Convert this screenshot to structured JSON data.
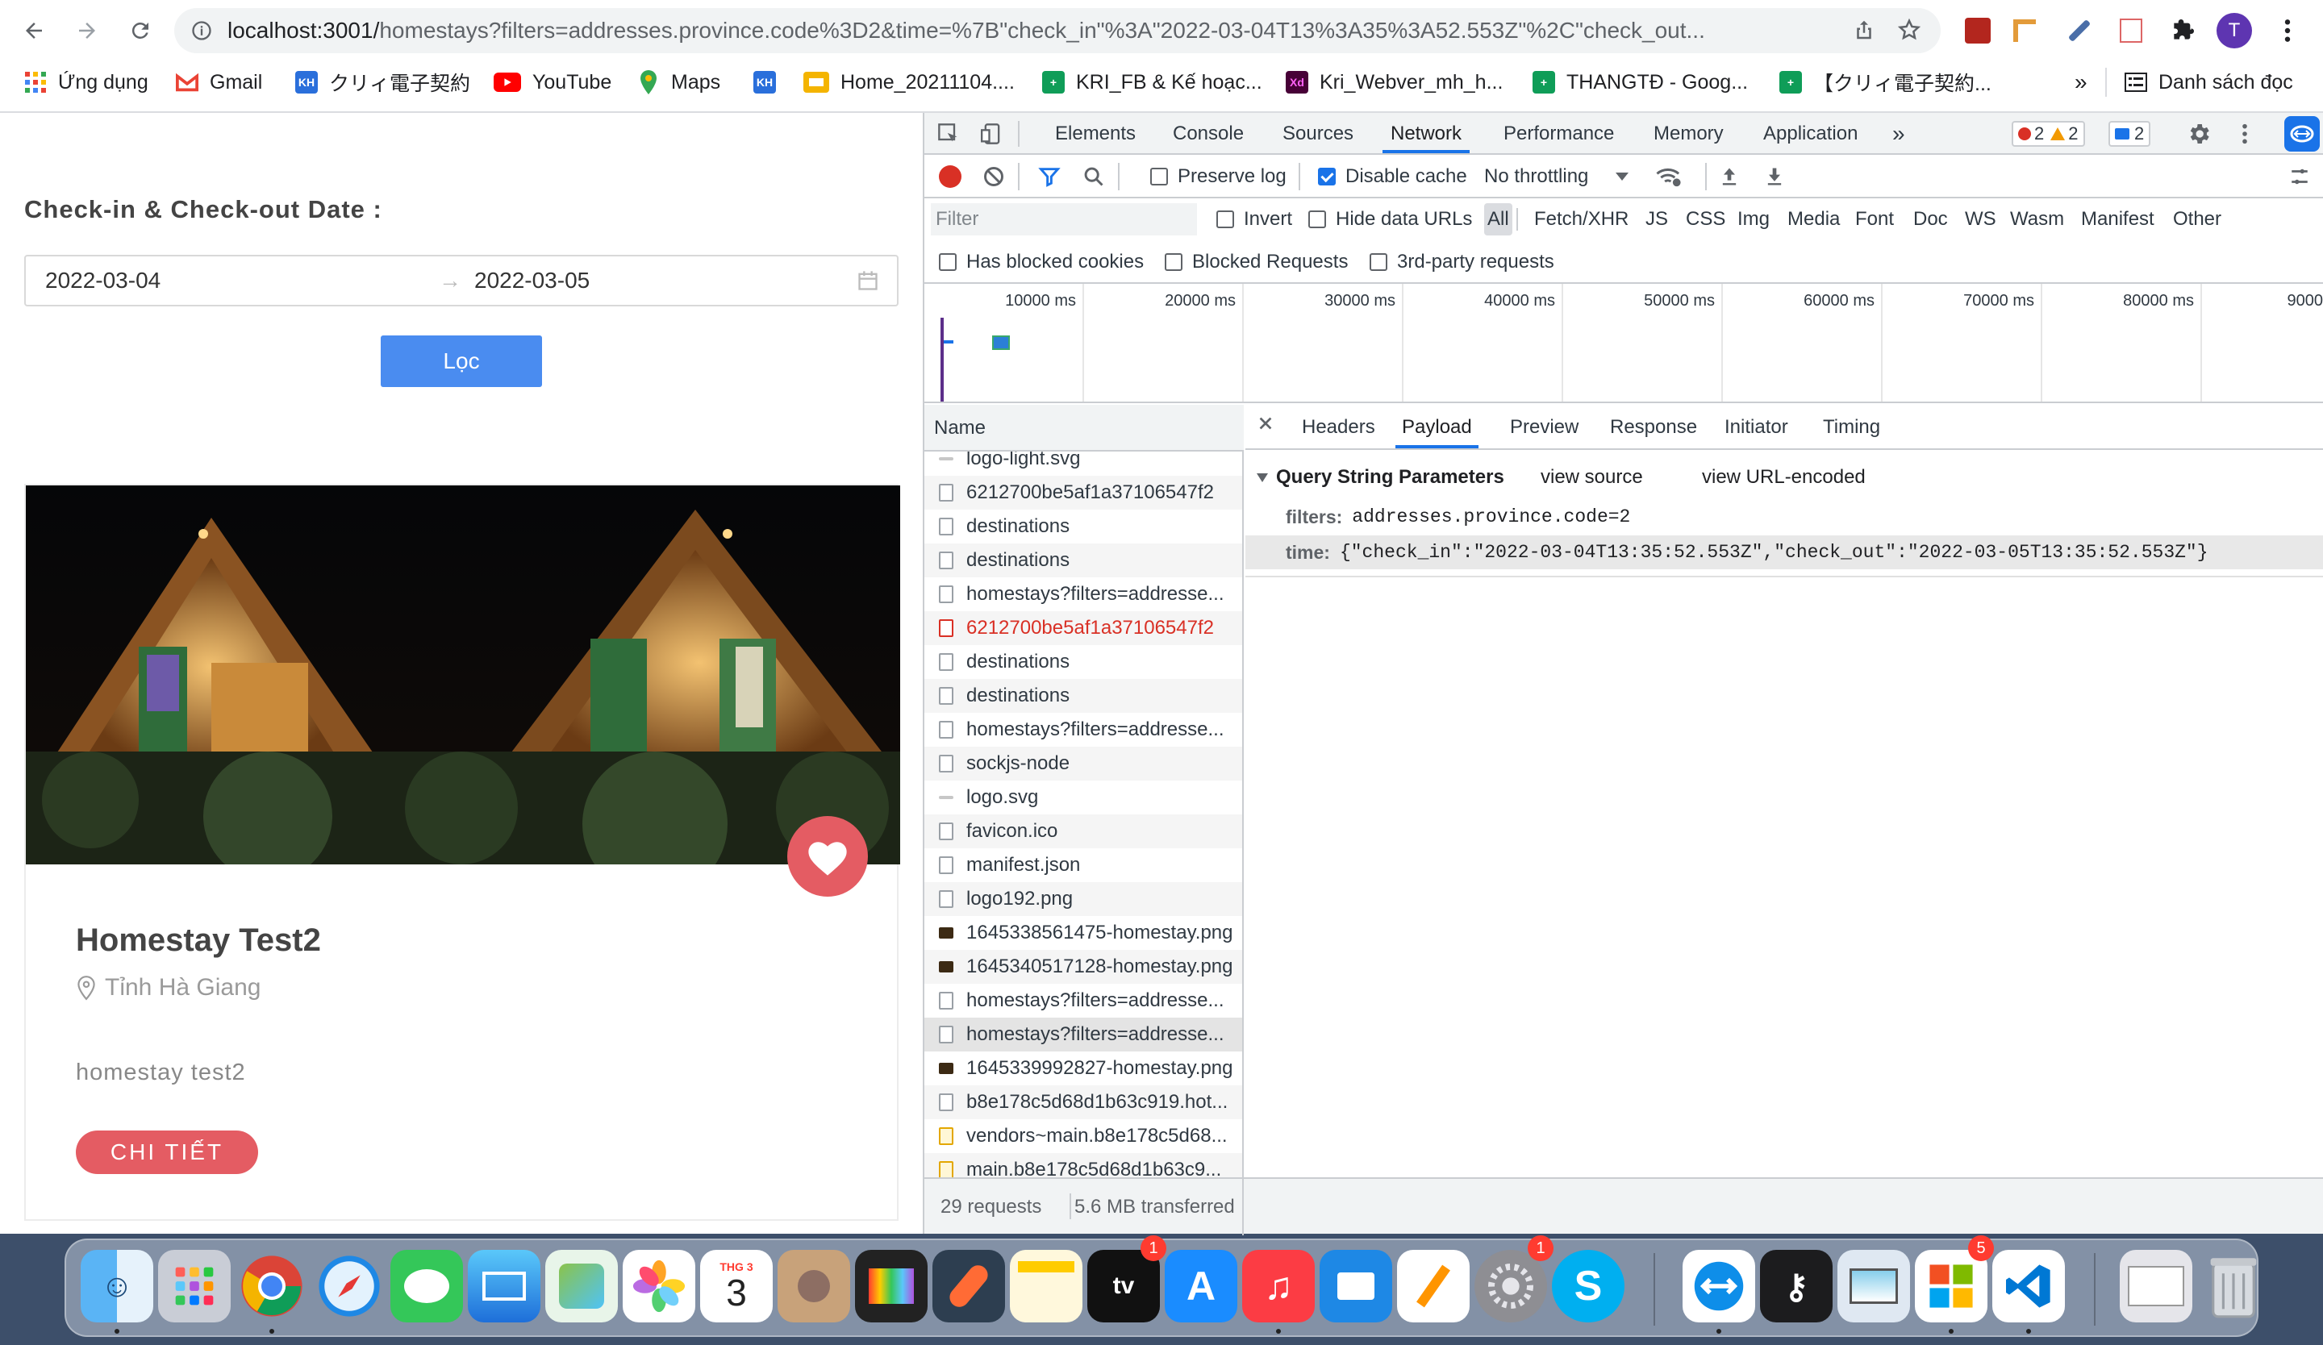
{
  "browser": {
    "url_host": "localhost:3001/",
    "url_rest": "homestays?filters=addresses.province.code%3D2&time=%7B\"check_in\"%3A\"2022-03-04T13%3A35%3A52.553Z\"%2C\"check_out...",
    "profile_initial": "T",
    "bookmarks": [
      {
        "label": "Ứng dụng",
        "icon": "apps-grid-icon"
      },
      {
        "label": "Gmail",
        "icon": "gmail-icon"
      },
      {
        "label": "クリィ電子契約",
        "icon": "kh-icon"
      },
      {
        "label": "YouTube",
        "icon": "youtube-icon"
      },
      {
        "label": "Maps",
        "icon": "maps-icon"
      },
      {
        "label": "",
        "icon": "kh-icon"
      },
      {
        "label": "Home_20211104....",
        "icon": "slides-icon"
      },
      {
        "label": "KRI_FB & Kế hoạc...",
        "icon": "sheets-icon"
      },
      {
        "label": "Kri_Webver_mh_h...",
        "icon": "xd-icon"
      },
      {
        "label": "THANGTĐ - Goog...",
        "icon": "sheets-icon"
      },
      {
        "label": "【クリィ電子契約...",
        "icon": "sheets-icon"
      }
    ],
    "bookmarks_overflow": "»",
    "reading_list": "Danh sách đọc"
  },
  "page": {
    "filter_label": "Check-in & Check-out Date :",
    "check_in": "2022-03-04",
    "check_out": "2022-03-05",
    "range_arrow": "→",
    "filter_button": "Lọc",
    "homestay": {
      "title": "Homestay Test2",
      "location": "Tỉnh Hà Giang",
      "description": "homestay test2",
      "detail_button": "CHI TIẾT"
    }
  },
  "devtools": {
    "tabs": [
      "Elements",
      "Console",
      "Sources",
      "Network",
      "Performance",
      "Memory",
      "Application"
    ],
    "more_tabs": "»",
    "errors": "2",
    "warnings": "2",
    "messages": "2",
    "toolbar": {
      "preserve_log": "Preserve log",
      "disable_cache": "Disable cache",
      "throttling": "No throttling"
    },
    "filter_placeholder": "Filter",
    "invert": "Invert",
    "hide_data_urls": "Hide data URLs",
    "types": [
      "All",
      "Fetch/XHR",
      "JS",
      "CSS",
      "Img",
      "Media",
      "Font",
      "Doc",
      "WS",
      "Wasm",
      "Manifest",
      "Other"
    ],
    "has_blocked_cookies": "Has blocked cookies",
    "blocked_requests": "Blocked Requests",
    "third_party": "3rd-party requests",
    "timeline_ticks": [
      "10000 ms",
      "20000 ms",
      "30000 ms",
      "40000 ms",
      "50000 ms",
      "60000 ms",
      "70000 ms",
      "80000 ms",
      "9000"
    ],
    "name_header": "Name",
    "requests": [
      {
        "name": "logo-light.svg",
        "type": "svg"
      },
      {
        "name": "6212700be5af1a37106547f2",
        "type": "doc"
      },
      {
        "name": "destinations",
        "type": "doc"
      },
      {
        "name": "destinations",
        "type": "doc"
      },
      {
        "name": "homestays?filters=addresse...",
        "type": "doc"
      },
      {
        "name": "6212700be5af1a37106547f2",
        "type": "err"
      },
      {
        "name": "destinations",
        "type": "doc"
      },
      {
        "name": "destinations",
        "type": "doc"
      },
      {
        "name": "homestays?filters=addresse...",
        "type": "doc"
      },
      {
        "name": "sockjs-node",
        "type": "doc"
      },
      {
        "name": "logo.svg",
        "type": "svg"
      },
      {
        "name": "favicon.ico",
        "type": "doc"
      },
      {
        "name": "manifest.json",
        "type": "doc"
      },
      {
        "name": "logo192.png",
        "type": "doc"
      },
      {
        "name": "1645338561475-homestay.png",
        "type": "img"
      },
      {
        "name": "1645340517128-homestay.png",
        "type": "img"
      },
      {
        "name": "homestays?filters=addresse...",
        "type": "doc"
      },
      {
        "name": "homestays?filters=addresse...",
        "type": "sel"
      },
      {
        "name": "1645339992827-homestay.png",
        "type": "img"
      },
      {
        "name": "b8e178c5d68d1b63c919.hot...",
        "type": "doc"
      },
      {
        "name": "vendors~main.b8e178c5d68...",
        "type": "js"
      },
      {
        "name": "main.b8e178c5d68d1b63c9...",
        "type": "js"
      }
    ],
    "status": {
      "requests": "29 requests",
      "transferred": "5.6 MB transferred"
    },
    "detail_tabs": [
      "Headers",
      "Payload",
      "Preview",
      "Response",
      "Initiator",
      "Timing"
    ],
    "payload": {
      "section": "Query String Parameters",
      "view_source": "view source",
      "view_url_encoded": "view URL-encoded",
      "params": [
        {
          "key": "filters:",
          "value": "addresses.province.code=2"
        },
        {
          "key": "time:",
          "value": "{\"check_in\":\"2022-03-04T13:35:52.553Z\",\"check_out\":\"2022-03-05T13:35:52.553Z\"}"
        }
      ]
    }
  },
  "dock": {
    "calendar_month": "THG 3",
    "calendar_day": "3",
    "badges": {
      "appletv": "1",
      "settings": "1",
      "office": "5"
    }
  }
}
